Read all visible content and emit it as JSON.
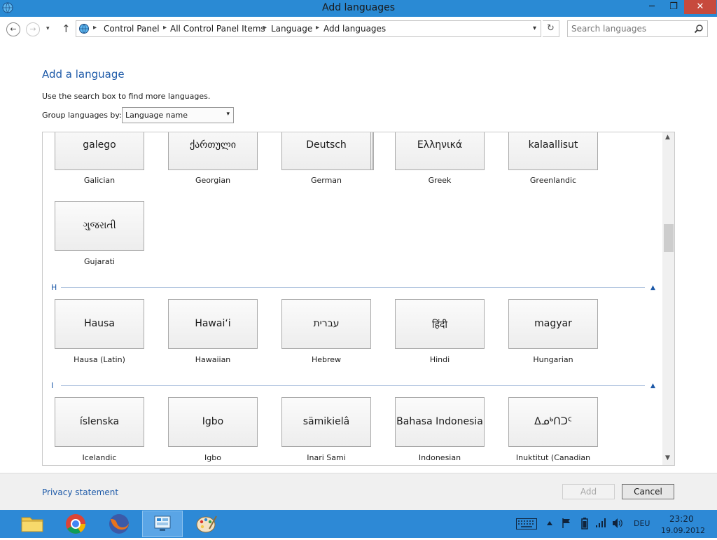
{
  "window": {
    "title": "Add languages"
  },
  "caption_buttons": {
    "minimize": "─",
    "maximize": "❐",
    "close": "✕"
  },
  "nav": {
    "back": "←",
    "forward": "→",
    "recent": "▾",
    "up": "↑",
    "breadcrumbs": [
      "Control Panel",
      "All Control Panel Items",
      "Language",
      "Add languages"
    ],
    "separator": "▸",
    "dropdown": "▾",
    "refresh": "↻",
    "search_placeholder": "Search languages"
  },
  "content": {
    "heading": "Add a language",
    "hint": "Use the search box to find more languages.",
    "group_label": "Group languages by:",
    "group_value": "Language name",
    "group_arrow": "▾"
  },
  "groups": [
    {
      "letter": "",
      "tiles": [
        {
          "native": "galego",
          "name": "Galician"
        },
        {
          "native": "ქართული",
          "name": "Georgian"
        },
        {
          "native": "Deutsch",
          "name": "German"
        },
        {
          "native": "Ελληνικά",
          "name": "Greek"
        },
        {
          "native": "kalaallisut",
          "name": "Greenlandic"
        },
        {
          "native": "ગુજરાતી",
          "name": "Gujarati"
        }
      ]
    },
    {
      "letter": "H",
      "tiles": [
        {
          "native": "Hausa",
          "name": "Hausa (Latin)"
        },
        {
          "native": "Hawaiʻi",
          "name": "Hawaiian"
        },
        {
          "native": "עברית",
          "name": "Hebrew"
        },
        {
          "native": "हिंदी",
          "name": "Hindi"
        },
        {
          "native": "magyar",
          "name": "Hungarian"
        }
      ]
    },
    {
      "letter": "I",
      "tiles": [
        {
          "native": "íslenska",
          "name": "Icelandic"
        },
        {
          "native": "Igbo",
          "name": "Igbo"
        },
        {
          "native": "sämikielâ",
          "name": "Inari Sami"
        },
        {
          "native": "Bahasa Indonesia",
          "name": "Indonesian"
        },
        {
          "native": "ᐃᓄᒃᑎᑐᑦ",
          "name": "Inuktitut (Canadian"
        }
      ]
    }
  ],
  "collapse_glyph": "▲",
  "scroll": {
    "up": "▲",
    "down": "▼"
  },
  "footer": {
    "privacy": "Privacy statement",
    "add": "Add",
    "cancel": "Cancel"
  },
  "taskbar": {
    "apps": [
      "file-explorer",
      "chrome",
      "firefox",
      "control-panel",
      "paint"
    ],
    "language": "DEU",
    "time": "23:20",
    "date": "19.09.2012"
  },
  "colors": {
    "titlebar": "#2a8ad4",
    "link": "#1e5aa8",
    "taskbar": "#2d89d6",
    "close": "#c74a3d"
  }
}
